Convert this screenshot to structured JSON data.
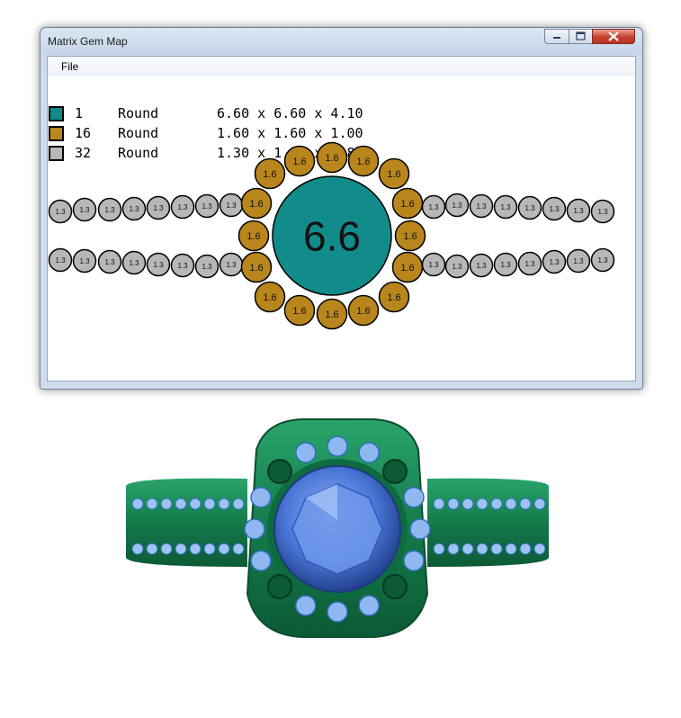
{
  "window": {
    "title": "Matrix Gem Map",
    "menu": [
      "File"
    ]
  },
  "legend": [
    {
      "count": "1",
      "shape": "Round",
      "dims": "6.60 x 6.60 x 4.10",
      "color": "#118c8a"
    },
    {
      "count": "16",
      "shape": "Round",
      "dims": "1.60 x 1.60 x 1.00",
      "color": "#b8861c"
    },
    {
      "count": "32",
      "shape": "Round",
      "dims": "1.30 x 1.30 x 0.80",
      "color": "#b7b7b7"
    }
  ],
  "gem_map": {
    "center_label": "6.6",
    "halo_label": "1.6",
    "band_label": "1.3",
    "colors": {
      "center": "#118c8a",
      "halo": "#b8861c",
      "band": "#b7b7b7"
    }
  },
  "ring_render": {
    "metal_color": "#1a8a5a",
    "center_stone_color": "#4a78d8",
    "accent_stone_color": "#8fb8f0"
  }
}
